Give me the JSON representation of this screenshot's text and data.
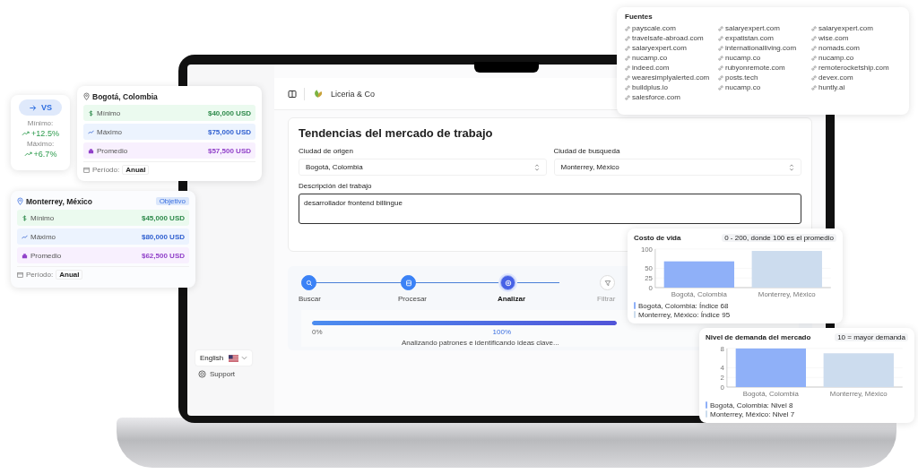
{
  "sources": {
    "title": "Fuentes",
    "links": [
      "payscale.com",
      "salaryexpert.com",
      "salaryexpert.com",
      "travelsafe-abroad.com",
      "expatistan.com",
      "wise.com",
      "salaryexpert.com",
      "internationalliving.com",
      "nomads.com",
      "nucamp.co",
      "nucamp.co",
      "nucamp.co",
      "indeed.com",
      "rubyonremote.com",
      "remoterocketship.com",
      "wearesimplyalerted.com",
      "posts.tech",
      "devex.com",
      "buildplus.io",
      "nucamp.co",
      "huntly.ai",
      "salesforce.com"
    ]
  },
  "comparison": {
    "button": "VS",
    "rows": [
      {
        "label": "Mínimo:",
        "change": "+12.5%"
      },
      {
        "label": "Máximo:",
        "change": "+6.7%"
      }
    ]
  },
  "city_cards": [
    {
      "city": "Bogotá, Colombia",
      "rows": [
        {
          "kind": "min",
          "label": "Mínimo",
          "value": "$40,000 USD"
        },
        {
          "kind": "max",
          "label": "Máximo",
          "value": "$75,000 USD"
        },
        {
          "kind": "avg",
          "label": "Promedio",
          "value": "$57,500 USD"
        }
      ],
      "period_label": "Período:",
      "period": "Anual"
    },
    {
      "city": "Monterrey, México",
      "badge": "Objetivo",
      "rows": [
        {
          "kind": "min",
          "label": "Mínimo",
          "value": "$45,000 USD"
        },
        {
          "kind": "max",
          "label": "Máximo",
          "value": "$80,000 USD"
        },
        {
          "kind": "avg",
          "label": "Promedio",
          "value": "$62,500 USD"
        }
      ],
      "period_label": "Período:",
      "period": "Anual"
    }
  ],
  "app": {
    "brand": "Liceria & Co",
    "language": "English",
    "support": "Support",
    "form": {
      "title": "Tendencias del mercado de trabajo",
      "origin_label": "Ciudad de origen",
      "origin": "Bogotá, Colombia",
      "target_label": "Ciudad de busqueda",
      "target": "Monterrey, México",
      "description_label": "Descripción del trabajo",
      "description": "desarrollador frontend billingue"
    },
    "steps": [
      {
        "label": "Buscar",
        "completed": true,
        "selected": false
      },
      {
        "label": "Procesar",
        "completed": true,
        "selected": false
      },
      {
        "label": "Analizar",
        "completed": false,
        "selected": true
      },
      {
        "label": "Filtrar",
        "completed": false,
        "selected": false
      }
    ],
    "progress": {
      "level": 1,
      "start": "0%",
      "reading": "100%",
      "message": "Analizando patrones e identificando ideas clave..."
    }
  },
  "charts": [
    {
      "badge": "0 - 200, donde 100 es el promedio",
      "legend": [
        "Bogotá, Colombia: Índice 68",
        "Monterrey, México: Índice 95"
      ],
      "chart_data": {
        "type": "bar",
        "title": "Costo de vida",
        "categories": [
          "Bogotá, Colombia",
          "Monterrey, México"
        ],
        "series": [
          {
            "color": "#8fb0f8",
            "values": [
              68,
              null
            ]
          },
          {
            "color": "#ccdcee",
            "values": [
              null,
              95
            ]
          }
        ],
        "ylim": [
          0,
          100
        ],
        "yticks": [
          0,
          25,
          50,
          100
        ]
      }
    },
    {
      "badge": "10 = mayor demanda",
      "legend": [
        "Bogotá, Colombia: Nivel 8",
        "Monterrey, México: Nivel 7"
      ],
      "chart_data": {
        "type": "bar",
        "title": "Nivel de demanda del mercado",
        "categories": [
          "Bogotá, Colombia",
          "Monterrey, México"
        ],
        "series": [
          {
            "color": "#8fb0f8",
            "values": [
              8,
              null
            ]
          },
          {
            "color": "#ccdcee",
            "values": [
              null,
              7
            ]
          }
        ],
        "ylim": [
          0,
          8
        ],
        "yticks": [
          0,
          2,
          4,
          8
        ]
      }
    }
  ]
}
